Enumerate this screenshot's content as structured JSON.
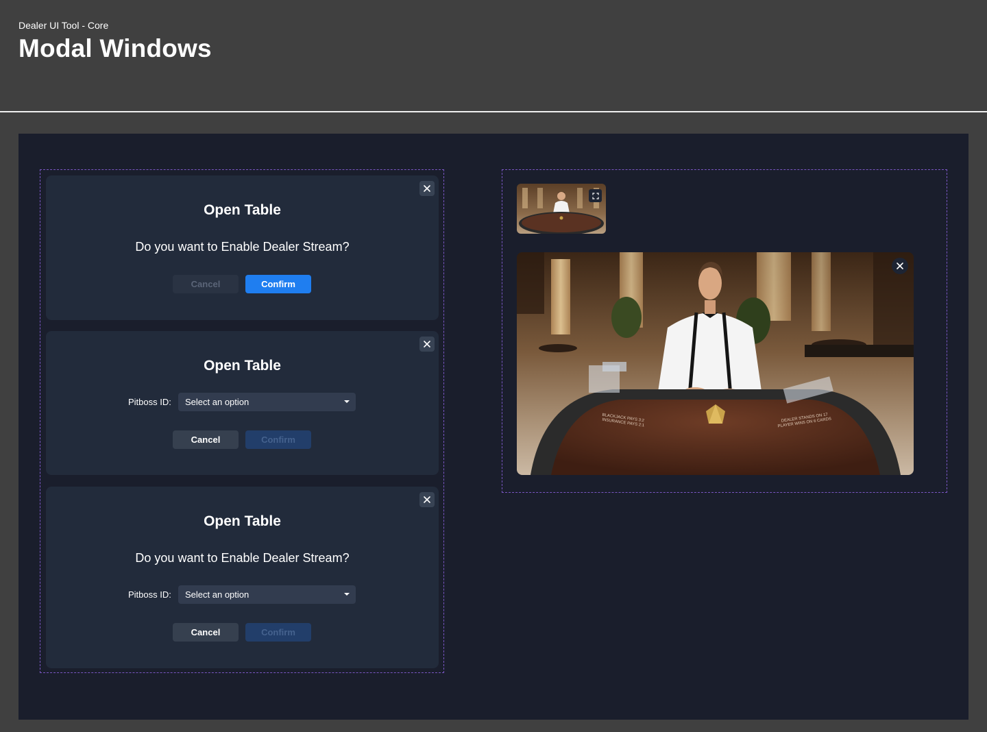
{
  "header": {
    "breadcrumb": "Dealer UI Tool - Core",
    "title": "Modal Windows"
  },
  "modals": [
    {
      "title": "Open Table",
      "question": "Do you want to Enable Dealer Stream?",
      "cancel_label": "Cancel",
      "confirm_label": "Confirm"
    },
    {
      "title": "Open Table",
      "field_label": "Pitboss ID:",
      "select_value": "Select an option",
      "cancel_label": "Cancel",
      "confirm_label": "Confirm"
    },
    {
      "title": "Open Table",
      "question": "Do you want to Enable Dealer Stream?",
      "field_label": "Pitboss ID:",
      "select_value": "Select an option",
      "cancel_label": "Cancel",
      "confirm_label": "Confirm"
    }
  ],
  "video": {
    "table_text_left_1": "BLACKJACK PAYS 3:2",
    "table_text_left_2": "INSURANCE PAYS 2:1",
    "table_text_right_1": "DEALER STANDS ON 17",
    "table_text_right_2": "PLAYER WINS ON 6 CARDS"
  },
  "icons": {
    "close": "close-icon",
    "expand": "expand-icon",
    "caret": "chevron-down-icon"
  },
  "colors": {
    "page_bg": "#404040",
    "canvas_bg": "#1a1e2c",
    "modal_bg": "#222b3b",
    "primary": "#1f7ef0",
    "guide_border": "#7a56c4"
  }
}
